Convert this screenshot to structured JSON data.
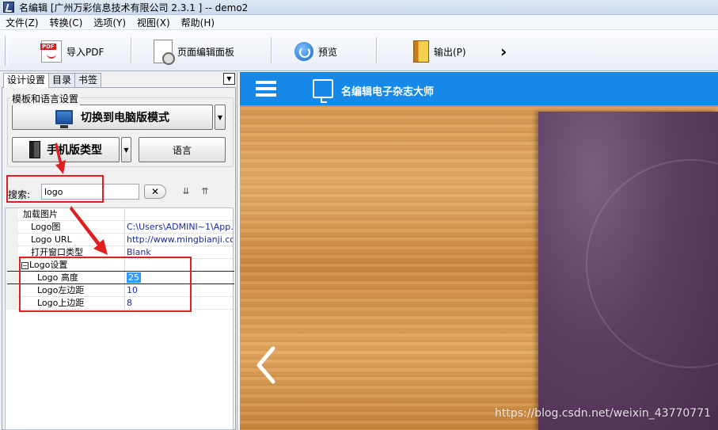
{
  "window": {
    "title": "名编辑 [广州万彩信息技术有限公司 2.3.1 ] -- demo2"
  },
  "menu": [
    "文件(Z)",
    "转换(C)",
    "选项(Y)",
    "视图(X)",
    "帮助(H)"
  ],
  "toolbar": {
    "import_pdf": "导入PDF",
    "page_editor": "页面编辑面板",
    "preview": "预览",
    "output": "输出(P)",
    "more": "›"
  },
  "left": {
    "tabs": [
      "设计设置",
      "目录",
      "书签"
    ],
    "group_label": "模板和语言设置",
    "switch_pc_mode": "切换到电脑版模式",
    "mobile_type": "手机版类型",
    "language": "语言",
    "search": {
      "label": "搜索:",
      "value": "logo",
      "clear": "✕"
    }
  },
  "properties": {
    "load_image_category": "加载图片",
    "rows": [
      {
        "name": "Logo图",
        "value": "C:\\Users\\ADMINI~1\\App..."
      },
      {
        "name": "Logo URL",
        "value": "http://www.mingbianji.com"
      },
      {
        "name": "打开窗口类型",
        "value": "Blank"
      }
    ],
    "logo_settings_category": "Logo设置",
    "logo_rows": [
      {
        "name": "Logo 高度",
        "value": "25"
      },
      {
        "name": "Logo左边距",
        "value": "10"
      },
      {
        "name": "Logo上边距",
        "value": "8"
      }
    ]
  },
  "preview": {
    "brand": "名编辑电子杂志大师",
    "watermark": "https://blog.csdn.net/weixin_43770771"
  },
  "colors": {
    "accent": "#1588e8",
    "annotation": "#e02020",
    "selection": "#3399ff"
  }
}
